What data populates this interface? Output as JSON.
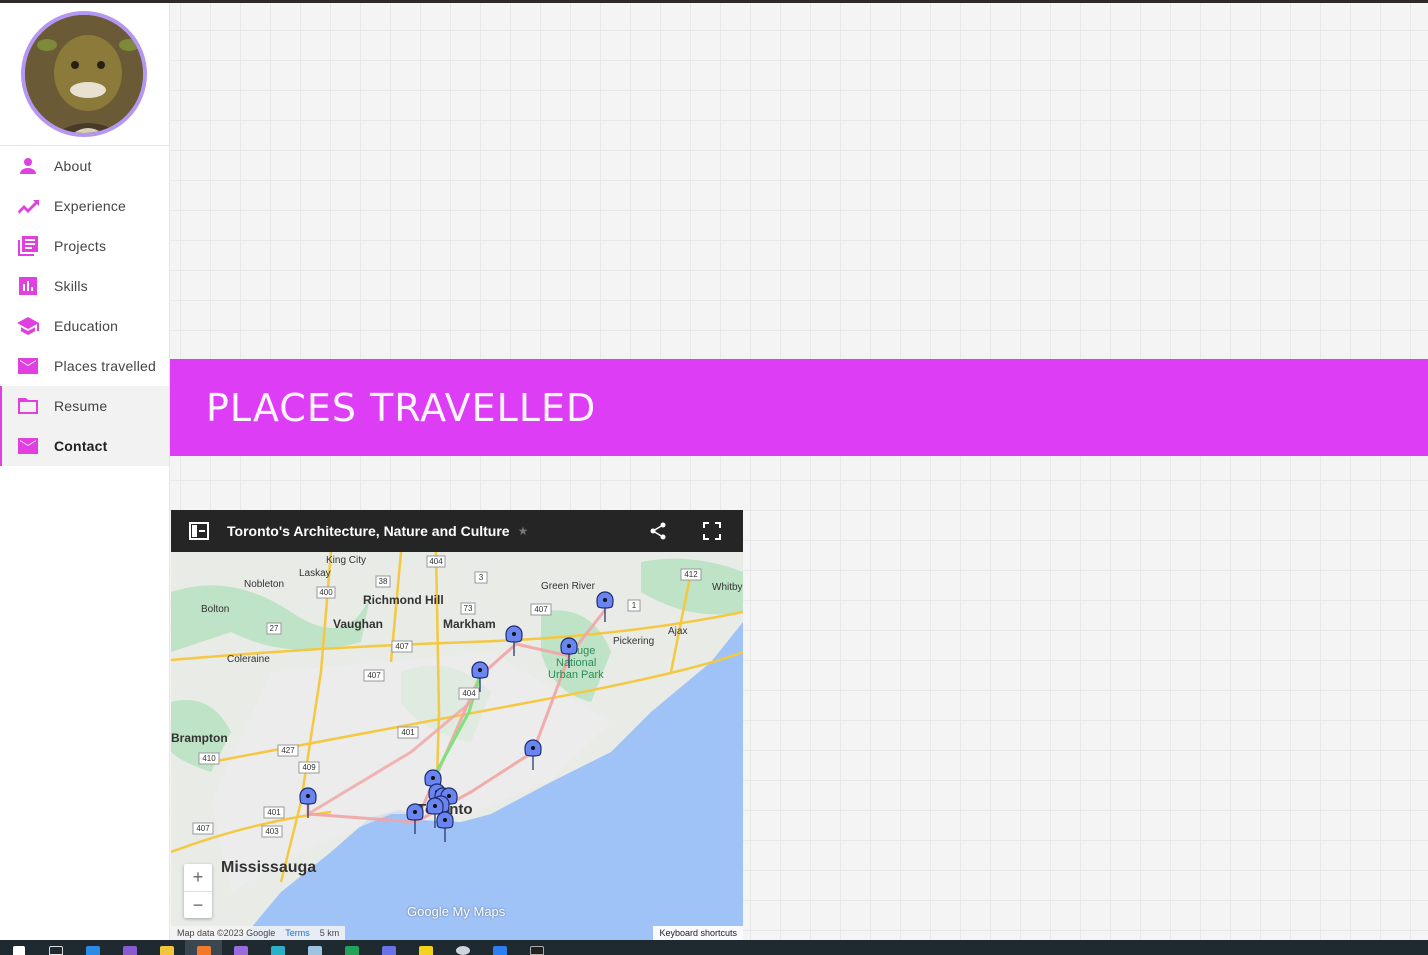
{
  "sidebar": {
    "items": [
      {
        "label": "About",
        "icon": "person-icon"
      },
      {
        "label": "Experience",
        "icon": "trending-up-icon"
      },
      {
        "label": "Projects",
        "icon": "library-books-icon"
      },
      {
        "label": "Skills",
        "icon": "bar-chart-icon"
      },
      {
        "label": "Education",
        "icon": "school-icon"
      },
      {
        "label": "Places travelled",
        "icon": "mail-icon"
      },
      {
        "label": "Resume",
        "icon": "folder-icon"
      },
      {
        "label": "Contact",
        "icon": "mail-icon"
      }
    ],
    "accent_color": "#e040e0",
    "avatar_ring_color": "#b497f0"
  },
  "banner": {
    "title": "PLACES TRAVELLED",
    "color": "#dd3ef5"
  },
  "map": {
    "title": "Toronto's Architecture, Nature and Culture",
    "attribution": "Map data ©2023 Google",
    "terms": "Terms",
    "scale": "5 km",
    "keyboard": "Keyboard shortcuts",
    "logo_google": "Google",
    "logo_mymaps": "My Maps",
    "labels": {
      "king_city": "King City",
      "laskay": "Laskay",
      "nobleton": "Nobleton",
      "bolton": "Bolton",
      "richmond_hill": "Richmond Hill",
      "vaughan": "Vaughan",
      "markham": "Markham",
      "green_river": "Green River",
      "whitby": "Whitby",
      "pickering": "Pickering",
      "ajax": "Ajax",
      "coleraine": "Coleraine",
      "rouge": "Rouge",
      "national": "National",
      "urban_park": "Urban Park",
      "brampton": "Brampton",
      "toronto": "Toronto",
      "mississauga": "Mississauga",
      "hwy_404": "404",
      "hwy_400": "400",
      "hwy_38": "38",
      "hwy_3": "3",
      "hwy_412": "412",
      "hwy_407": "407",
      "hwy_73": "73",
      "hwy_27": "27",
      "hwy_1": "1",
      "hwy_401": "401",
      "hwy_427": "427",
      "hwy_410": "410",
      "hwy_409": "409",
      "hwy_403": "403"
    }
  },
  "taskbar": {
    "icons": [
      "windows-start-icon",
      "task-view-icon",
      "vscode-icon",
      "visual-studio-icon",
      "file-explorer-icon",
      "firefox-icon",
      "visual-studio-2-icon",
      "edge-icon",
      "notepad-icon",
      "excel-icon",
      "discord-icon",
      "sticky-notes-icon",
      "settings-icon",
      "zoom-icon",
      "terminal-icon"
    ]
  }
}
